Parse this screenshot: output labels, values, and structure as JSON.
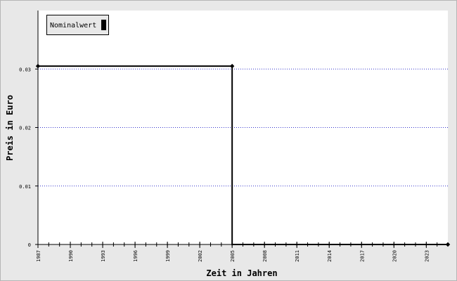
{
  "chart_data": {
    "type": "line",
    "xlabel": "Zeit in Jahren",
    "ylabel": "Preis in Euro",
    "legend": [
      "Nominalwert"
    ],
    "legend_position": "top-left",
    "xlim": [
      1987,
      2025
    ],
    "ylim": [
      0,
      0.04
    ],
    "x_ticks": [
      "1987",
      "1990",
      "1993",
      "1996",
      "1999",
      "2002",
      "2005",
      "2008",
      "2011",
      "2014",
      "2017",
      "2020",
      "2023"
    ],
    "y_ticks": [
      "0",
      "0.01",
      "0.02",
      "0.03"
    ],
    "grid": "horizontal dotted",
    "series": [
      {
        "name": "Nominalwert",
        "step": true,
        "points": [
          {
            "x": 1987,
            "y": 0.0305
          },
          {
            "x": 2005,
            "y": 0.0305
          },
          {
            "x": 2005,
            "y": 0
          },
          {
            "x": 2025,
            "y": 0
          }
        ],
        "markers": [
          {
            "x": 1987,
            "y": 0.0305
          },
          {
            "x": 2005,
            "y": 0.0305
          },
          {
            "x": 2025,
            "y": 0
          }
        ]
      }
    ],
    "colors": {
      "line": "#000000",
      "grid": "#3333cc",
      "plot_bg": "#ffffff",
      "frame_bg": "#e8e8e8"
    }
  }
}
